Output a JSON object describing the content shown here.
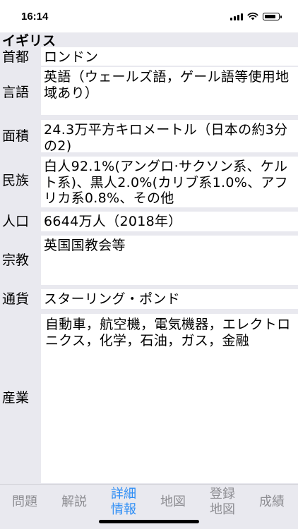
{
  "status": {
    "time": "16:14"
  },
  "country": "イギリス",
  "fields": [
    {
      "label": "首都",
      "value": "ロンドン"
    },
    {
      "label": "言語",
      "value": "英語（ウェールズ語，ゲール語等使用地域あり）"
    },
    {
      "label": "面積",
      "value": "24.3万平方キロメートル（日本の約3分の2)"
    },
    {
      "label": "民族",
      "value": "白人92.1%(アングロ·サクソン系、ケルト系)、黒人2.0%(カリブ系1.0%、アフリカ系0.8%、その他"
    },
    {
      "label": "人口",
      "value": "6644万人（2018年）"
    },
    {
      "label": "宗教",
      "value": "英国国教会等"
    },
    {
      "label": "通貨",
      "value": "スターリング・ポンド"
    },
    {
      "label": "産業",
      "value": "自動車，航空機，電気機器，エレクトロニクス，化学，石油，ガス，金融"
    }
  ],
  "tabs": [
    {
      "label": "問題"
    },
    {
      "label": "解説"
    },
    {
      "label": "詳細\n情報",
      "active": true
    },
    {
      "label": "地図"
    },
    {
      "label": "登録\n地図"
    },
    {
      "label": "成績"
    }
  ],
  "colors": {
    "accent": "#2f8ef5",
    "inactive": "#8e8e93",
    "background": "#e9e9ef",
    "cell": "#ffffff"
  }
}
